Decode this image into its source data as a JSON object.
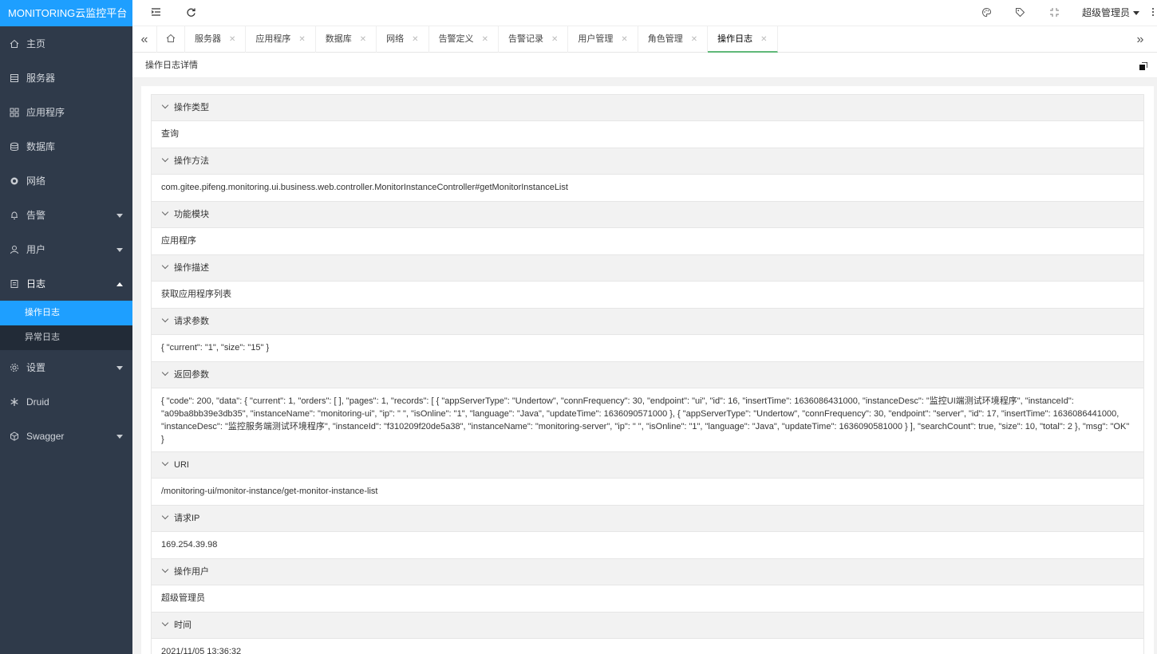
{
  "app": {
    "title": "MONITORING云监控平台"
  },
  "sidebar": {
    "items": [
      {
        "label": "主页",
        "icon": "home-icon"
      },
      {
        "label": "服务器",
        "icon": "server-icon"
      },
      {
        "label": "应用程序",
        "icon": "apps-icon"
      },
      {
        "label": "数据库",
        "icon": "database-icon"
      },
      {
        "label": "网络",
        "icon": "network-icon"
      },
      {
        "label": "告警",
        "icon": "bell-icon"
      },
      {
        "label": "用户",
        "icon": "user-icon"
      },
      {
        "label": "日志",
        "icon": "log-icon"
      },
      {
        "label": "设置",
        "icon": "gear-icon"
      },
      {
        "label": "Druid",
        "icon": "snowflake-icon"
      },
      {
        "label": "Swagger",
        "icon": "swagger-icon"
      }
    ],
    "log_sub": [
      "操作日志",
      "异常日志"
    ]
  },
  "header": {
    "user": "超级管理员"
  },
  "tabs": [
    "服务器",
    "应用程序",
    "数据库",
    "网络",
    "告警定义",
    "告警记录",
    "用户管理",
    "角色管理",
    "操作日志"
  ],
  "page": {
    "title": "操作日志详情"
  },
  "details": [
    {
      "title": "操作类型",
      "value": "查询"
    },
    {
      "title": "操作方法",
      "value": "com.gitee.pifeng.monitoring.ui.business.web.controller.MonitorInstanceController#getMonitorInstanceList"
    },
    {
      "title": "功能模块",
      "value": "应用程序"
    },
    {
      "title": "操作描述",
      "value": "获取应用程序列表"
    },
    {
      "title": "请求参数",
      "value": "{ \"current\": \"1\", \"size\": \"15\" }"
    },
    {
      "title": "返回参数",
      "value": "{ \"code\": 200, \"data\": { \"current\": 1, \"orders\": [ ], \"pages\": 1, \"records\": [ { \"appServerType\": \"Undertow\", \"connFrequency\": 30, \"endpoint\": \"ui\", \"id\": 16, \"insertTime\": 1636086431000, \"instanceDesc\": \"监控UI端测试环境程序\", \"instanceId\": \"a09ba8bb39e3db35\", \"instanceName\": \"monitoring-ui\", \"ip\": \"                      \", \"isOnline\": \"1\", \"language\": \"Java\", \"updateTime\": 1636090571000 }, { \"appServerType\": \"Undertow\", \"connFrequency\": 30, \"endpoint\": \"server\", \"id\": 17, \"insertTime\": 1636086441000, \"instanceDesc\": \"监控服务端测试环境程序\", \"instanceId\": \"f310209f20de5a38\", \"instanceName\": \"monitoring-server\", \"ip\": \"                      \", \"isOnline\": \"1\", \"language\": \"Java\", \"updateTime\": 1636090581000 } ], \"searchCount\": true, \"size\": 10, \"total\": 2 }, \"msg\": \"OK\" }"
    },
    {
      "title": "URI",
      "value": "/monitoring-ui/monitor-instance/get-monitor-instance-list"
    },
    {
      "title": "请求IP",
      "value": "169.254.39.98"
    },
    {
      "title": "操作用户",
      "value": "超级管理员"
    },
    {
      "title": "时间",
      "value": "2021/11/05 13:36:32"
    }
  ]
}
